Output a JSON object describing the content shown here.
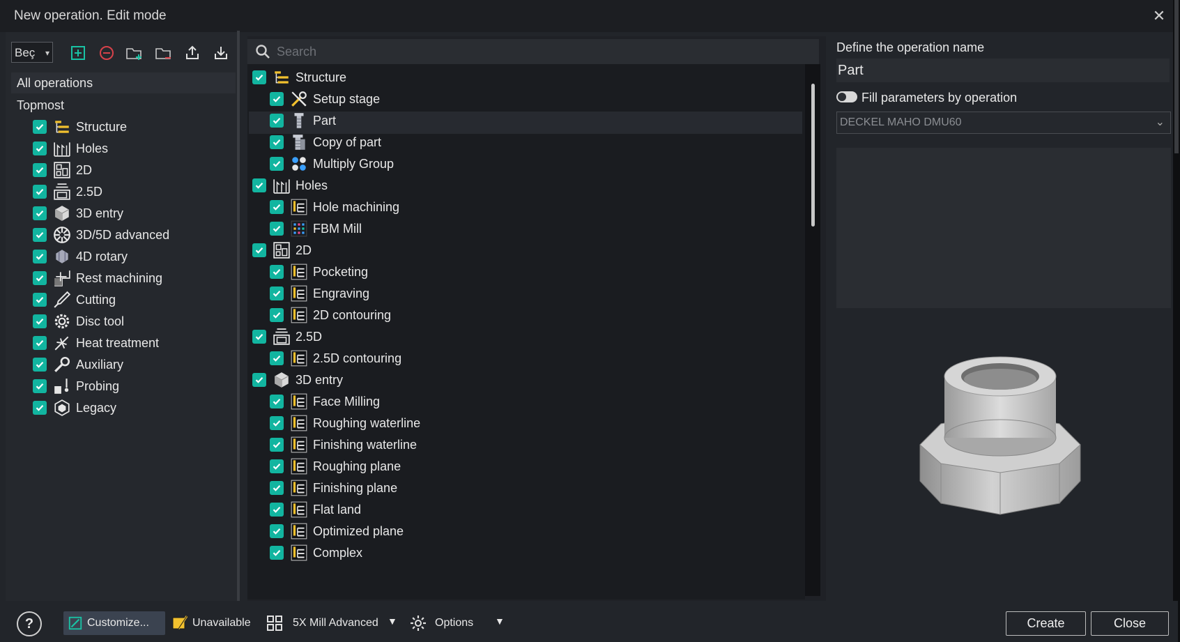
{
  "window": {
    "title": "New operation. Edit mode",
    "close_glyph": "✕"
  },
  "left": {
    "combo_value": "Beç",
    "toolbar_icons": [
      "add-icon",
      "remove-icon",
      "add-folder-icon",
      "remove-folder-icon",
      "export-icon",
      "import-icon"
    ],
    "all_operations": "All operations",
    "topmost": "Topmost",
    "items": [
      {
        "label": "Structure",
        "icon": "structure-icon"
      },
      {
        "label": "Holes",
        "icon": "holes-icon"
      },
      {
        "label": "2D",
        "icon": "2d-icon"
      },
      {
        "label": "2.5D",
        "icon": "2-5d-icon"
      },
      {
        "label": "3D entry",
        "icon": "3d-entry-icon"
      },
      {
        "label": "3D/5D advanced",
        "icon": "3d-5d-advanced-icon"
      },
      {
        "label": "4D rotary",
        "icon": "4d-rotary-icon"
      },
      {
        "label": "Rest machining",
        "icon": "rest-machining-icon"
      },
      {
        "label": "Cutting",
        "icon": "cutting-icon"
      },
      {
        "label": "Disc tool",
        "icon": "disc-tool-icon"
      },
      {
        "label": "Heat treatment",
        "icon": "heat-treatment-icon"
      },
      {
        "label": "Auxiliary",
        "icon": "auxiliary-icon"
      },
      {
        "label": "Probing",
        "icon": "probing-icon"
      },
      {
        "label": "Legacy",
        "icon": "legacy-icon"
      }
    ]
  },
  "middle": {
    "search_placeholder": "Search",
    "items": [
      {
        "label": "Structure",
        "level": 0,
        "icon": "structure-icon"
      },
      {
        "label": "Setup stage",
        "level": 1,
        "icon": "setup-stage-icon"
      },
      {
        "label": "Part",
        "level": 1,
        "icon": "part-icon",
        "selected": true
      },
      {
        "label": "Copy of part",
        "level": 1,
        "icon": "copy-of-part-icon"
      },
      {
        "label": "Multiply Group",
        "level": 1,
        "icon": "multiply-group-icon"
      },
      {
        "label": "Holes",
        "level": 0,
        "icon": "holes-icon"
      },
      {
        "label": "Hole machining",
        "level": 1,
        "icon": "hole-machining-icon"
      },
      {
        "label": "FBM Mill",
        "level": 1,
        "icon": "fbm-mill-icon"
      },
      {
        "label": "2D",
        "level": 0,
        "icon": "2d-icon"
      },
      {
        "label": "Pocketing",
        "level": 1,
        "icon": "pocketing-icon"
      },
      {
        "label": "Engraving",
        "level": 1,
        "icon": "engraving-icon"
      },
      {
        "label": "2D contouring",
        "level": 1,
        "icon": "2d-contouring-icon"
      },
      {
        "label": "2.5D",
        "level": 0,
        "icon": "2-5d-icon"
      },
      {
        "label": "2.5D contouring",
        "level": 1,
        "icon": "2-5d-contouring-icon"
      },
      {
        "label": "3D entry",
        "level": 0,
        "icon": "3d-entry-icon"
      },
      {
        "label": "Face Milling",
        "level": 1,
        "icon": "face-milling-icon"
      },
      {
        "label": "Roughing waterline",
        "level": 1,
        "icon": "roughing-waterline-icon"
      },
      {
        "label": "Finishing waterline",
        "level": 1,
        "icon": "finishing-waterline-icon"
      },
      {
        "label": "Roughing plane",
        "level": 1,
        "icon": "roughing-plane-icon"
      },
      {
        "label": "Finishing plane",
        "level": 1,
        "icon": "finishing-plane-icon"
      },
      {
        "label": "Flat land",
        "level": 1,
        "icon": "flat-land-icon"
      },
      {
        "label": "Optimized plane",
        "level": 1,
        "icon": "optimized-plane-icon"
      },
      {
        "label": "Complex",
        "level": 1,
        "icon": "complex-icon"
      }
    ]
  },
  "right": {
    "name_label": "Define the operation name",
    "name_value": "Part",
    "fill_label": "Fill parameters by operation",
    "machine": "DECKEL MAHO DMU60"
  },
  "bottom": {
    "help": "?",
    "customize": "Customize...",
    "unavailable": "Unavailable",
    "mode": "5X Mill Advanced",
    "options": "Options",
    "create": "Create",
    "close": "Close"
  },
  "colors": {
    "checkbox": "#12b5a0",
    "accent_yellow": "#f2c12e",
    "panel": "#22252a"
  }
}
